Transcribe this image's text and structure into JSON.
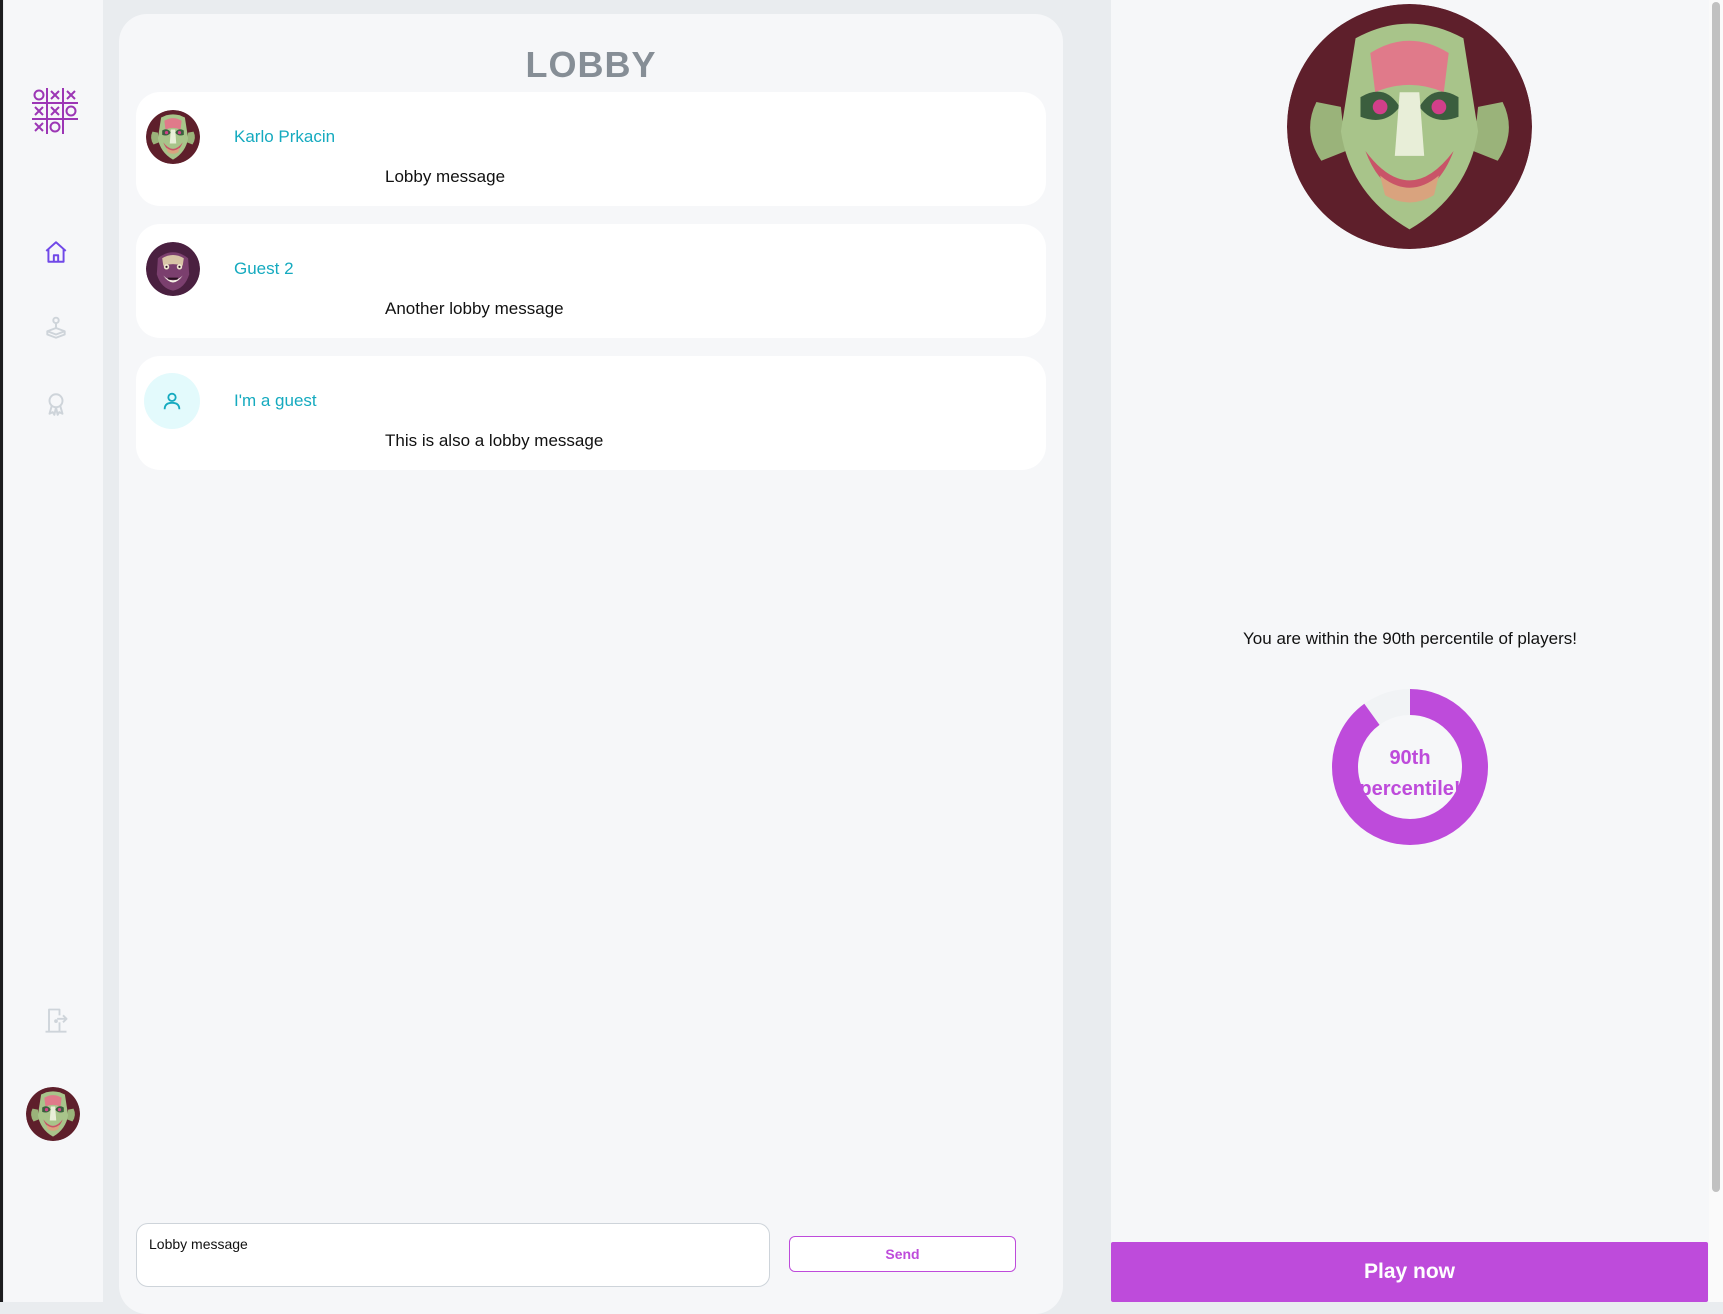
{
  "sidebar": {
    "logo_icon": "tic-tac-toe-logo-icon",
    "nav_items": [
      {
        "id": "home",
        "icon": "home-icon",
        "active": true
      },
      {
        "id": "play",
        "icon": "joystick-icon",
        "active": false
      },
      {
        "id": "leaderboard",
        "icon": "award-icon",
        "active": false
      }
    ],
    "logout_icon": "logout-door-icon",
    "avatar_icon": "mask-avatar-icon"
  },
  "lobby": {
    "title": "LOBBY",
    "messages": [
      {
        "author": "Karlo Prkacin",
        "text": "Lobby message",
        "avatar": "mask-avatar-icon"
      },
      {
        "author": "Guest 2",
        "text": "Another lobby message",
        "avatar": "purple-mask-avatar-icon"
      },
      {
        "author": "I'm a guest",
        "text": "This is also a lobby message",
        "avatar": "user-placeholder-icon"
      }
    ],
    "input": {
      "value": "Lobby message"
    },
    "send_label": "Send"
  },
  "profile": {
    "avatar": "mask-avatar-icon",
    "percentile_text": "You are within the 90th percentile of players!",
    "percentile_value": 90,
    "donut_line1": "90th",
    "donut_line2": "percentile!",
    "play_label": "Play now"
  },
  "colors": {
    "accent": "#be4bdb",
    "name": "#15aabf",
    "nav_active": "#7048e8",
    "nav_inactive": "#ced4da",
    "title": "#868e96"
  }
}
